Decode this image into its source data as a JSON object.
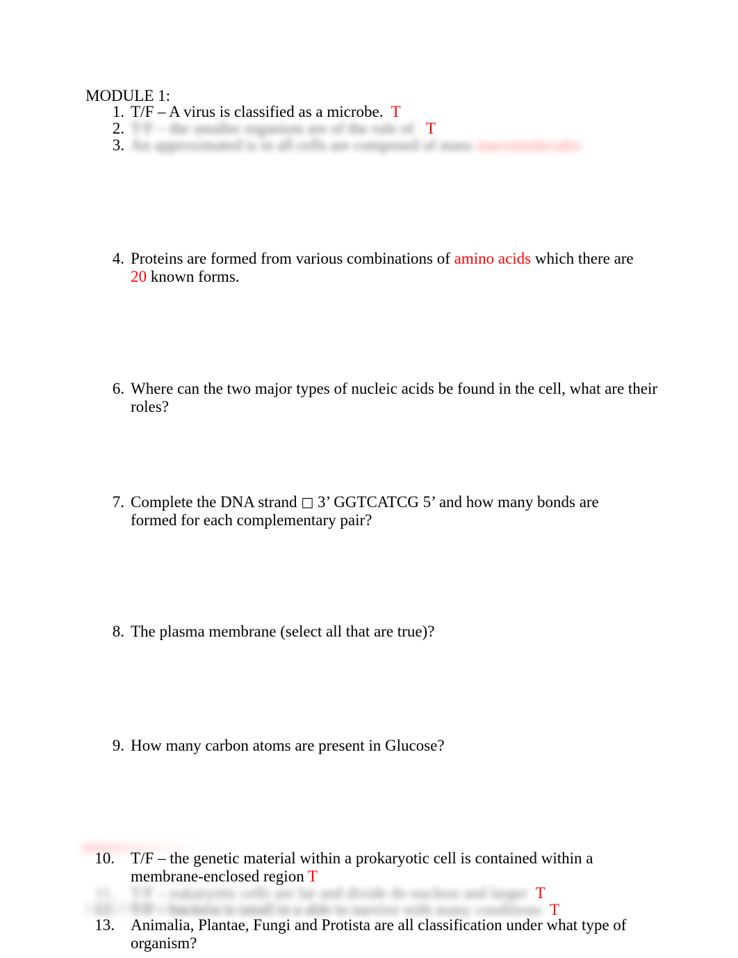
{
  "document": {
    "heading": "MODULE 1:",
    "page_background": "#ffffff",
    "text_color": "#000000",
    "answer_color": "#ff0000"
  },
  "questions": [
    {
      "number": "1.",
      "text_before": "T/F – A virus is classified as a microbe.",
      "answer": "T",
      "blurred": false
    },
    {
      "number": "2.",
      "text_before": "T/F – the smaller organism are of the rule of",
      "answer": "T",
      "blurred": true
    },
    {
      "number": "3.",
      "text_before": "An approximated is in all cells are composed of mass",
      "answer_redacted": "macromolecules",
      "blurred": true
    },
    {
      "number": "4.",
      "segment_1": "Proteins are formed from various combinations of ",
      "highlight_1": "amino acids",
      "segment_2": " which there are ",
      "highlight_2": "20",
      "segment_3": " known forms.",
      "blurred": false
    },
    {
      "number": "6.",
      "text_before": "Where can the two major types of nucleic acids be found in the cell, what are their roles?",
      "blurred": false
    },
    {
      "number": "7.",
      "segment_1": "Complete the DNA strand ",
      "glyph": "□",
      "segment_2": "  3’ GGTCATCG 5’ and how many bonds are formed for each complementary pair?",
      "blurred": false
    },
    {
      "number": "8.",
      "text_before": "The plasma membrane (select all that are true)?",
      "blurred": false
    },
    {
      "number": "9.",
      "text_before": "How many carbon atoms are present in Glucose?",
      "blurred": false
    },
    {
      "number": "10.",
      "text_before": "T/F – the genetic material within a prokaryotic cell is contained within a membrane-enclosed region",
      "answer": "T",
      "blurred": false
    },
    {
      "number": "11.",
      "text_before": "T/F – eukaryotic cells are far and divide do nucleus and larger",
      "answer": "T",
      "blurred": true
    },
    {
      "number": "12.",
      "text_before": "T/F – bacteria is small in a able to survive with many conditions",
      "answer": "T",
      "blurred": true
    },
    {
      "number": "13.",
      "text_before": "Animalia, Plantae, Fungi and Protista are all classification under what type of organism?",
      "blurred": false
    }
  ]
}
